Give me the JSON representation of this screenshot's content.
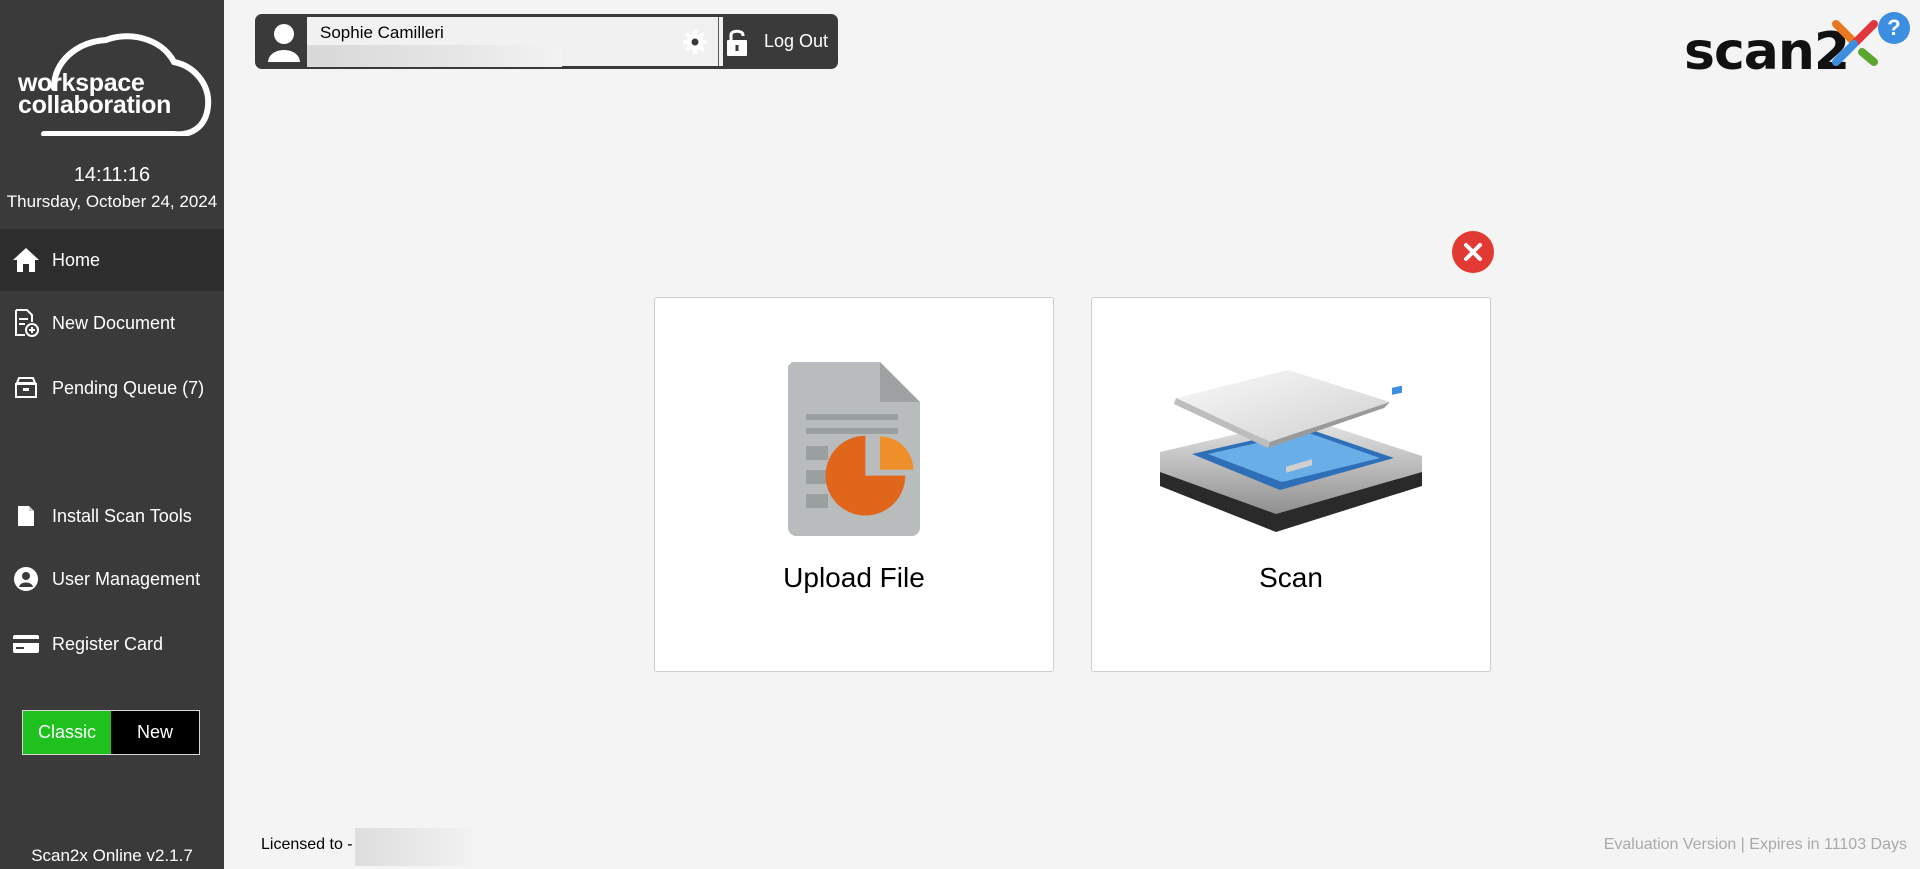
{
  "sidebar": {
    "logo": {
      "line1": "workspace",
      "line2": "collaboration"
    },
    "clock": {
      "time": "14:11:16",
      "date": "Thursday, October 24, 2024"
    },
    "items": [
      {
        "label": "Home",
        "icon": "home-icon"
      },
      {
        "label": "New Document",
        "icon": "new-document-icon"
      },
      {
        "label": "Pending Queue (7)",
        "icon": "pending-queue-icon"
      },
      {
        "label": "Install Scan Tools",
        "icon": "install-icon"
      },
      {
        "label": "User Management",
        "icon": "user-icon"
      },
      {
        "label": "Register Card",
        "icon": "card-icon"
      }
    ],
    "mode": {
      "classic": "Classic",
      "new": "New"
    },
    "version": "Scan2x Online v2.1.7"
  },
  "userbar": {
    "name": "Sophie Camilleri",
    "logout_label": "Log Out"
  },
  "brand": {
    "name": "scan2",
    "help": "?"
  },
  "cards": [
    {
      "label": "Upload File"
    },
    {
      "label": "Scan"
    }
  ],
  "footer": {
    "licensed": "Licensed to -",
    "evaluation": "Evaluation Version | Expires in 11103 Days"
  },
  "colors": {
    "sidebar_bg": "#3a3a3a",
    "classic_green": "#1fc11f",
    "close_red": "#e03a32",
    "help_blue": "#3b8ee0",
    "file_orange": "#e0661c"
  }
}
